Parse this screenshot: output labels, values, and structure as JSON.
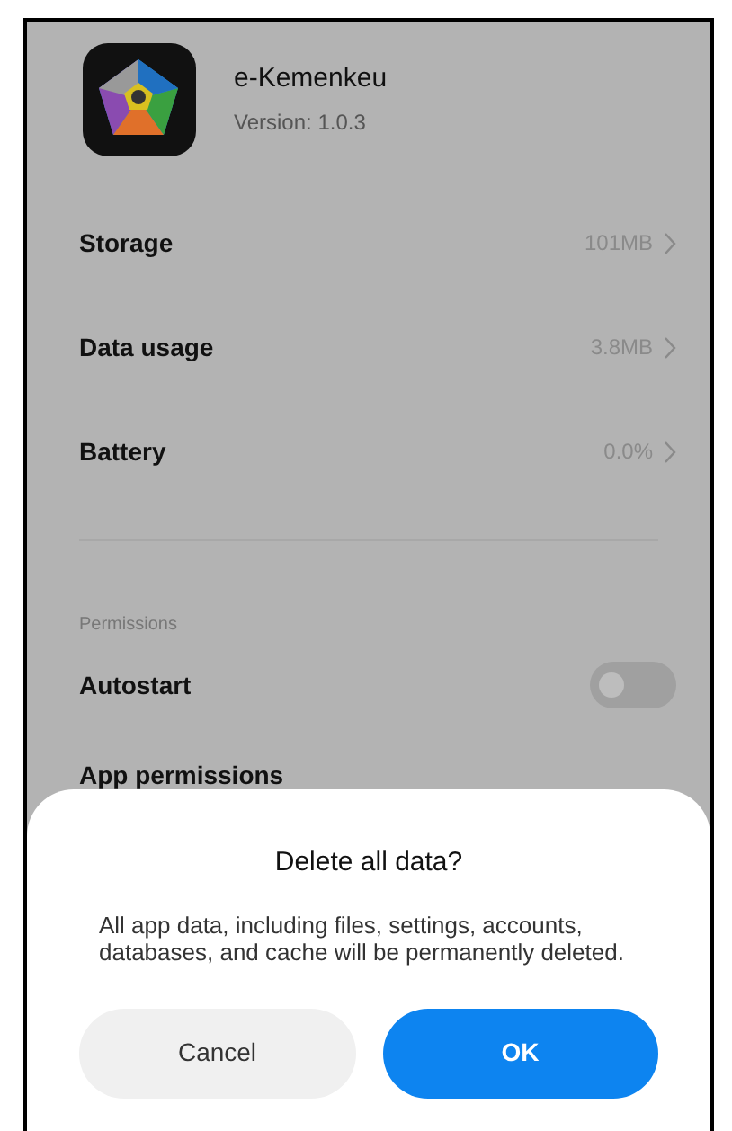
{
  "app": {
    "name": "e-Kemenkeu",
    "version": "Version: 1.0.3"
  },
  "rows": [
    {
      "label": "Storage",
      "value": "101MB"
    },
    {
      "label": "Data usage",
      "value": "3.8MB"
    },
    {
      "label": "Battery",
      "value": "0.0%"
    }
  ],
  "section": "Permissions",
  "permission_rows": [
    {
      "kind": "toggle",
      "label": "Autostart",
      "on": false
    },
    {
      "kind": "link",
      "label": "App permissions"
    }
  ],
  "dialog": {
    "title": "Delete all data?",
    "message": "All app data, including files, settings, accounts, databases, and cache will be permanently deleted.",
    "buttons": [
      {
        "label": "Cancel",
        "kind": "secondary"
      },
      {
        "label": "OK",
        "kind": "primary"
      }
    ]
  }
}
